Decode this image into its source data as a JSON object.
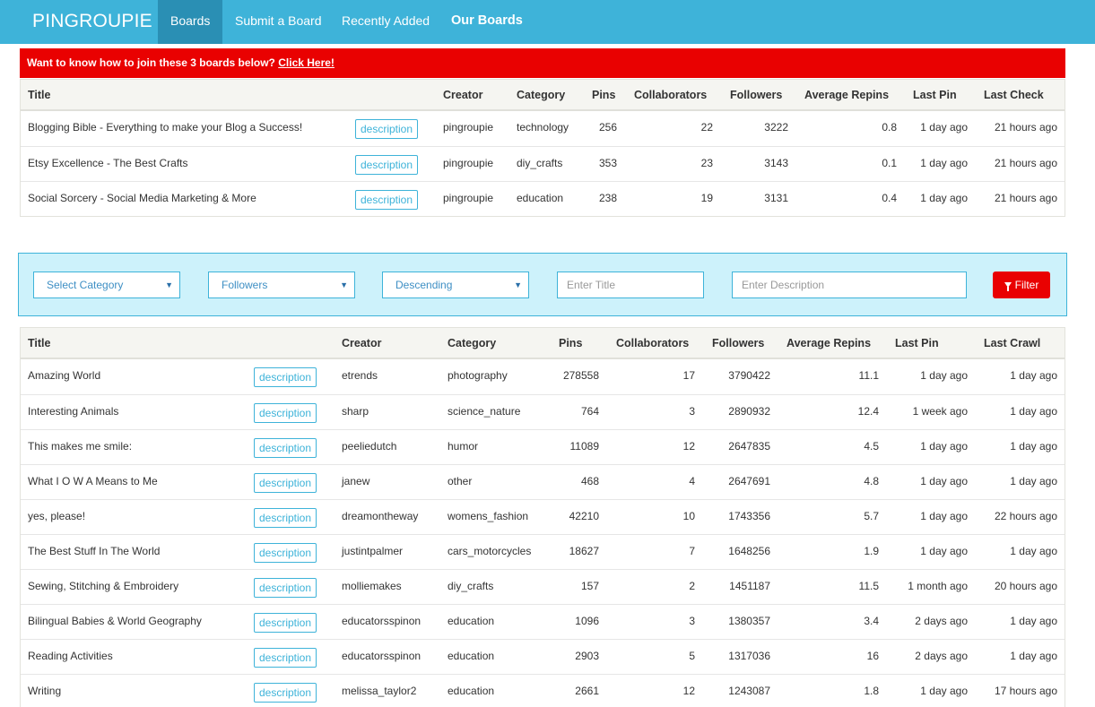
{
  "nav": {
    "brand": "PINGROUPIE",
    "items": [
      {
        "label": "Boards",
        "active": true
      },
      {
        "label": "Submit a Board"
      },
      {
        "label": "Recently Added"
      },
      {
        "label": "Our Boards"
      }
    ]
  },
  "promo": {
    "text": "Want to know how to join these 3 boards below?",
    "link": "Click Here!"
  },
  "our_boards": {
    "headers": [
      "Title",
      "Creator",
      "Category",
      "Pins",
      "Collaborators",
      "Followers",
      "Average Repins",
      "Last Pin",
      "Last Check"
    ],
    "description_label": "description",
    "rows": [
      {
        "title": "Blogging Bible - Everything to make your Blog a Success!",
        "creator": "pingroupie",
        "category": "technology",
        "pins": "256",
        "collaborators": "22",
        "followers": "3222",
        "avg_repins": "0.8",
        "last_pin": "1 day ago",
        "last_check": "21 hours ago"
      },
      {
        "title": "Etsy Excellence - The Best Crafts",
        "creator": "pingroupie",
        "category": "diy_crafts",
        "pins": "353",
        "collaborators": "23",
        "followers": "3143",
        "avg_repins": "0.1",
        "last_pin": "1 day ago",
        "last_check": "21 hours ago"
      },
      {
        "title": "Social Sorcery - Social Media Marketing & More",
        "creator": "pingroupie",
        "category": "education",
        "pins": "238",
        "collaborators": "19",
        "followers": "3131",
        "avg_repins": "0.4",
        "last_pin": "1 day ago",
        "last_check": "21 hours ago"
      }
    ]
  },
  "filters": {
    "category": "Select Category",
    "sort_by": "Followers",
    "order": "Descending",
    "title_placeholder": "Enter Title",
    "description_placeholder": "Enter Description",
    "button": "Filter"
  },
  "boards": {
    "headers": [
      "Title",
      "Creator",
      "Category",
      "Pins",
      "Collaborators",
      "Followers",
      "Average Repins",
      "Last Pin",
      "Last Crawl"
    ],
    "description_label": "description",
    "rows": [
      {
        "title": "Amazing World",
        "creator": "etrends",
        "category": "photography",
        "pins": "278558",
        "collaborators": "17",
        "followers": "3790422",
        "avg_repins": "11.1",
        "last_pin": "1 day ago",
        "last_crawl": "1 day ago"
      },
      {
        "title": "Interesting Animals",
        "creator": "sharp",
        "category": "science_nature",
        "pins": "764",
        "collaborators": "3",
        "followers": "2890932",
        "avg_repins": "12.4",
        "last_pin": "1 week ago",
        "last_crawl": "1 day ago"
      },
      {
        "title": "This makes me smile:",
        "creator": "peeliedutch",
        "category": "humor",
        "pins": "11089",
        "collaborators": "12",
        "followers": "2647835",
        "avg_repins": "4.5",
        "last_pin": "1 day ago",
        "last_crawl": "1 day ago"
      },
      {
        "title": "What I O W A Means to Me",
        "creator": "janew",
        "category": "other",
        "pins": "468",
        "collaborators": "4",
        "followers": "2647691",
        "avg_repins": "4.8",
        "last_pin": "1 day ago",
        "last_crawl": "1 day ago"
      },
      {
        "title": "yes, please!",
        "creator": "dreamontheway",
        "category": "womens_fashion",
        "pins": "42210",
        "collaborators": "10",
        "followers": "1743356",
        "avg_repins": "5.7",
        "last_pin": "1 day ago",
        "last_crawl": "22 hours ago"
      },
      {
        "title": "The Best Stuff In The World",
        "creator": "justintpalmer",
        "category": "cars_motorcycles",
        "pins": "18627",
        "collaborators": "7",
        "followers": "1648256",
        "avg_repins": "1.9",
        "last_pin": "1 day ago",
        "last_crawl": "1 day ago"
      },
      {
        "title": "Sewing, Stitching & Embroidery",
        "creator": "molliemakes",
        "category": "diy_crafts",
        "pins": "157",
        "collaborators": "2",
        "followers": "1451187",
        "avg_repins": "11.5",
        "last_pin": "1 month ago",
        "last_crawl": "20 hours ago"
      },
      {
        "title": "Bilingual Babies & World Geography",
        "creator": "educatorsspinon",
        "category": "education",
        "pins": "1096",
        "collaborators": "3",
        "followers": "1380357",
        "avg_repins": "3.4",
        "last_pin": "2 days ago",
        "last_crawl": "1 day ago"
      },
      {
        "title": "Reading Activities",
        "creator": "educatorsspinon",
        "category": "education",
        "pins": "2903",
        "collaborators": "5",
        "followers": "1317036",
        "avg_repins": "16",
        "last_pin": "2 days ago",
        "last_crawl": "1 day ago"
      },
      {
        "title": "Writing",
        "creator": "melissa_taylor2",
        "category": "education",
        "pins": "2661",
        "collaborators": "12",
        "followers": "1243087",
        "avg_repins": "1.8",
        "last_pin": "1 day ago",
        "last_crawl": "17 hours ago"
      }
    ]
  }
}
